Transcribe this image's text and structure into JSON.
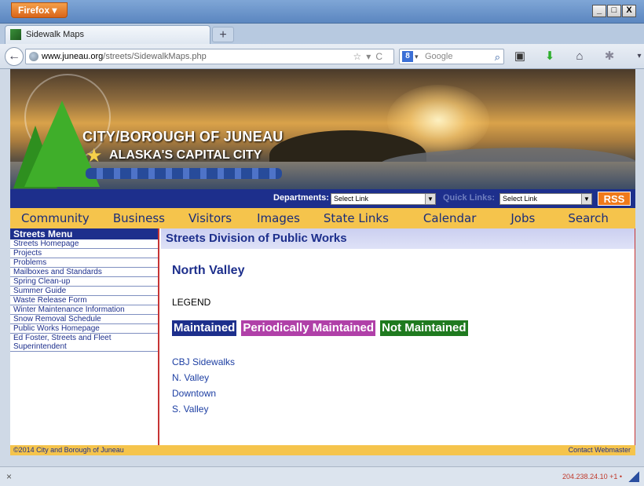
{
  "browser": {
    "menu_button": "Firefox",
    "window_controls": [
      "_",
      "□",
      "X"
    ],
    "tab_title": "Sidewalk Maps",
    "new_tab": "+",
    "url_host": "www.juneau.org",
    "url_path": "/streets/SidewalkMaps.php",
    "search_placeholder": "Google",
    "search_engine_icon": "8",
    "status_left": "×",
    "status_ip": "204.238.24.10 +1 •"
  },
  "banner": {
    "title": "CITY/BOROUGH OF JUNEAU",
    "subtitle": "ALASKA'S CAPITAL CITY"
  },
  "dept_bar": {
    "departments_label": "Departments:",
    "departments_value": "Select Link",
    "quicklinks_label": "Quick Links:",
    "quicklinks_value": "Select Link",
    "rss": "RSS"
  },
  "topnav": [
    "Community",
    "Business",
    "Visitors",
    "Images",
    "State Links",
    "Calendar",
    "Jobs",
    "Search"
  ],
  "sidebar": {
    "heading": "Streets Menu",
    "items": [
      "Streets Homepage",
      "Projects",
      "Problems",
      "Mailboxes and Standards",
      "Spring Clean-up",
      "Summer Guide",
      "Waste Release Form",
      "Winter Maintenance Information",
      "Snow Removal Schedule",
      "Public Works Homepage",
      "Ed Foster, Streets and Fleet Superintendent"
    ]
  },
  "main": {
    "heading": "Streets Division of Public Works",
    "title": "North Valley",
    "legend": "LEGEND",
    "tags": [
      {
        "label": "Maintained",
        "color": "#1d2f8c"
      },
      {
        "label": "Periodically Maintained",
        "color": "#b040a8"
      },
      {
        "label": "Not Maintained",
        "color": "#1f7a1f"
      }
    ],
    "links": [
      "CBJ Sidewalks",
      "N. Valley",
      "Downtown",
      "S. Valley"
    ]
  },
  "footer": {
    "copyright": "©2014 City and Borough of Juneau",
    "contact": "Contact Webmaster"
  }
}
